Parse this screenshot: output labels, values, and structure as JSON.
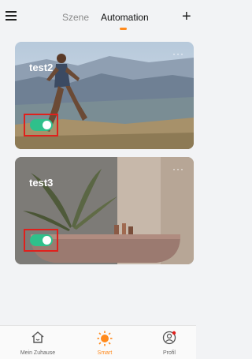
{
  "header": {
    "tabs": [
      {
        "label": "Szene",
        "active": false
      },
      {
        "label": "Automation",
        "active": true
      }
    ],
    "menu_icon": "hamburger-menu-icon",
    "add_icon": "plus-icon",
    "add_symbol": "+"
  },
  "cards": [
    {
      "title": "test2",
      "more": "···",
      "enabled": true
    },
    {
      "title": "test3",
      "more": "···",
      "enabled": true
    }
  ],
  "bottom_nav": [
    {
      "label": "Mein Zuhause",
      "icon": "home-icon",
      "active": false
    },
    {
      "label": "Smart",
      "icon": "sun-icon",
      "active": true
    },
    {
      "label": "Profil",
      "icon": "profile-icon",
      "active": false
    }
  ],
  "colors": {
    "accent": "#ff8a1c",
    "toggle_on": "#2fc08b",
    "highlight_box": "#e0201c",
    "background": "#f2f3f5"
  }
}
